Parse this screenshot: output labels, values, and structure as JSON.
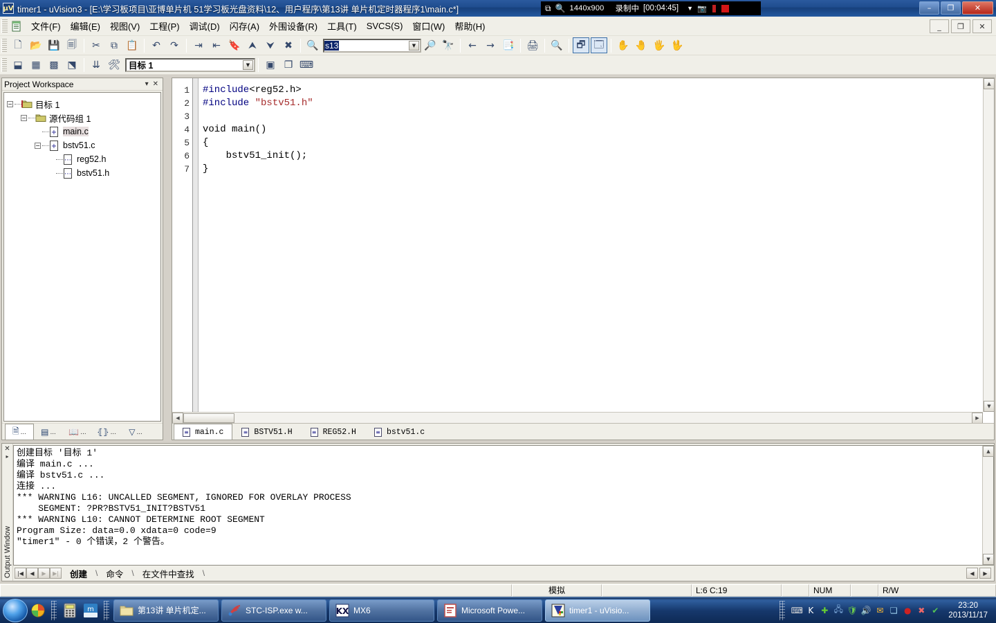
{
  "titlebar": {
    "text": "timer1  - uVision3 - [E:\\学习板项目\\亚博单片机 51学习板光盘资料\\12、用户程序\\第13讲 单片机定时器程序1\\main.c*]",
    "app_icon": "uvision-icon",
    "minimize": "–",
    "restore": "❐",
    "close": "✕"
  },
  "recorder": {
    "window_icon": "window-icon",
    "zoom_icon": "magnifier-icon",
    "resolution": "1440x900",
    "status": "录制中",
    "elapsed": "[00:04:45]",
    "caret": "▼",
    "camera_icon": "camera-icon",
    "pause_icon": "pause-icon",
    "stop_icon": "stop-icon"
  },
  "menubar": {
    "items": [
      {
        "label": "文件(F)"
      },
      {
        "label": "编辑(E)"
      },
      {
        "label": "视图(V)"
      },
      {
        "label": "工程(P)"
      },
      {
        "label": "调试(D)"
      },
      {
        "label": "闪存(A)"
      },
      {
        "label": "外围设备(R)"
      },
      {
        "label": "工具(T)"
      },
      {
        "label": "SVCS(S)"
      },
      {
        "label": "窗口(W)"
      },
      {
        "label": "帮助(H)"
      }
    ],
    "mdi_minimize": "_",
    "mdi_restore": "❐",
    "mdi_close": "✕"
  },
  "toolbar1": {
    "buttons": [
      {
        "name": "new-file-icon",
        "glyph": "🗋"
      },
      {
        "name": "open-file-icon",
        "glyph": "📂"
      },
      {
        "name": "save-icon",
        "glyph": "💾"
      },
      {
        "name": "save-all-icon",
        "glyph": "🗐"
      },
      {
        "name": "cut-icon",
        "glyph": "✂"
      },
      {
        "name": "copy-icon",
        "glyph": "⧉"
      },
      {
        "name": "paste-icon",
        "glyph": "📋"
      },
      {
        "name": "undo-icon",
        "glyph": "↶"
      },
      {
        "name": "redo-icon",
        "glyph": "↷"
      },
      {
        "name": "indent-icon",
        "glyph": "⇥"
      },
      {
        "name": "outdent-icon",
        "glyph": "⇤"
      },
      {
        "name": "bookmark-toggle-icon",
        "glyph": "🔖"
      },
      {
        "name": "bookmark-prev-icon",
        "glyph": "⮝"
      },
      {
        "name": "bookmark-next-icon",
        "glyph": "⮟"
      },
      {
        "name": "bookmark-clear-icon",
        "glyph": "✖"
      },
      {
        "name": "find-in-files-icon",
        "glyph": "🔍"
      }
    ],
    "search_value": "s13",
    "search_dropdown": "▼",
    "after_buttons": [
      {
        "name": "find-icon",
        "glyph": "🔎"
      },
      {
        "name": "find-next-icon",
        "glyph": "🔭"
      },
      {
        "name": "navigate-back-icon",
        "glyph": "←"
      },
      {
        "name": "navigate-forward-icon",
        "glyph": "→"
      },
      {
        "name": "bookmark-list-icon",
        "glyph": "📑"
      },
      {
        "name": "print-icon",
        "glyph": "🖨"
      },
      {
        "name": "print-preview-icon",
        "glyph": "🔍"
      },
      {
        "name": "project-window-icon",
        "glyph": "🗗"
      },
      {
        "name": "output-window-icon",
        "glyph": "🗔"
      },
      {
        "name": "debug-hand1-icon",
        "glyph": "✋"
      },
      {
        "name": "debug-hand2-icon",
        "glyph": "🤚"
      },
      {
        "name": "debug-hand3-icon",
        "glyph": "🖐"
      },
      {
        "name": "debug-hand4-icon",
        "glyph": "🖖"
      }
    ]
  },
  "toolbar2": {
    "buttons": [
      {
        "name": "build-icon",
        "glyph": "⬓"
      },
      {
        "name": "rebuild-icon",
        "glyph": "▦"
      },
      {
        "name": "build-all-icon",
        "glyph": "▩"
      },
      {
        "name": "stop-build-icon",
        "glyph": "⬔"
      },
      {
        "name": "download-icon",
        "glyph": "⇊"
      },
      {
        "name": "target-options-icon",
        "glyph": "🛠"
      }
    ],
    "target_value": "目标 1",
    "target_dropdown": "▼",
    "after_buttons": [
      {
        "name": "manage-components-icon",
        "glyph": "▣"
      },
      {
        "name": "multi-project-icon",
        "glyph": "❐"
      },
      {
        "name": "keyboard-icon",
        "glyph": "⌨"
      }
    ]
  },
  "project_workspace": {
    "title": "Project Workspace",
    "menu_caret": "▾",
    "close": "✕",
    "tree": [
      {
        "label": "目标 1",
        "level": 0,
        "expander": "−",
        "icon": "target-folder-icon",
        "selected": false
      },
      {
        "label": "源代码组 1",
        "level": 1,
        "expander": "−",
        "icon": "source-group-folder-icon",
        "selected": false
      },
      {
        "label": "main.c",
        "level": 2,
        "expander": "",
        "icon": "c-file-icon",
        "selected": true
      },
      {
        "label": "bstv51.c",
        "level": 2,
        "expander": "−",
        "icon": "c-file-icon",
        "selected": false
      },
      {
        "label": "reg52.h",
        "level": 3,
        "expander": "",
        "icon": "h-file-icon",
        "selected": false
      },
      {
        "label": "bstv51.h",
        "level": 3,
        "expander": "",
        "icon": "h-file-icon",
        "selected": false
      }
    ],
    "tabs": [
      {
        "name": "files-tab",
        "glyph": "🗎",
        "label": "...",
        "active": true
      },
      {
        "name": "regs-tab",
        "glyph": "▤",
        "label": "...",
        "active": false
      },
      {
        "name": "books-tab",
        "glyph": "📖",
        "label": "...",
        "active": false
      },
      {
        "name": "functions-tab",
        "glyph": "⦃⦄",
        "label": "...",
        "active": false
      },
      {
        "name": "templates-tab",
        "glyph": "▽",
        "label": "...",
        "active": false
      }
    ]
  },
  "editor": {
    "line_numbers": [
      "1",
      "2",
      "3",
      "4",
      "5",
      "6",
      "7"
    ],
    "lines": [
      {
        "segments": [
          {
            "text": "#include",
            "style": "kw-inc"
          },
          {
            "text": "<reg52.h>",
            "style": "plain"
          }
        ]
      },
      {
        "segments": [
          {
            "text": "#include",
            "style": "kw-inc"
          },
          {
            "text": " ",
            "style": "plain"
          },
          {
            "text": "\"bstv51.h\"",
            "style": "str"
          }
        ]
      },
      {
        "segments": [
          {
            "text": "",
            "style": "plain"
          }
        ]
      },
      {
        "segments": [
          {
            "text": "void main()",
            "style": "plain"
          }
        ]
      },
      {
        "segments": [
          {
            "text": "{",
            "style": "plain"
          }
        ]
      },
      {
        "segments": [
          {
            "text": "    bstv51_init();",
            "style": "plain"
          }
        ]
      },
      {
        "segments": [
          {
            "text": "}",
            "style": "plain"
          }
        ]
      }
    ],
    "scroll_up": "▲",
    "scroll_down": "▼",
    "scroll_left": "◀",
    "scroll_right": "▶",
    "tabs": [
      {
        "label": "main.c",
        "active": true
      },
      {
        "label": "BSTV51.H",
        "active": false
      },
      {
        "label": "REG52.H",
        "active": false
      },
      {
        "label": "bstv51.c",
        "active": false
      }
    ]
  },
  "output_window": {
    "vertical_label": "Output Window",
    "close": "✕",
    "pin": "▸",
    "text": "创建目标 '目标 1'\n编译 main.c ...\n编译 bstv51.c ...\n连接 ...\n*** WARNING L16: UNCALLED SEGMENT, IGNORED FOR OVERLAY PROCESS\n    SEGMENT: ?PR?BSTV51_INIT?BSTV51\n*** WARNING L10: CANNOT DETERMINE ROOT SEGMENT\nProgram Size: data=0.0 xdata=0 code=9\n\"timer1\" - 0 个错误，2 个警告。",
    "nav_first": "|◀",
    "nav_prev": "◀",
    "nav_next": "▶",
    "nav_last": "▶|",
    "tabs": [
      {
        "label": "创建",
        "active": true
      },
      {
        "label": "命令",
        "active": false
      },
      {
        "label": "在文件中查找",
        "active": false
      }
    ],
    "scroll_up": "▲",
    "scroll_down": "▼",
    "scroll_left": "◀",
    "scroll_right": "▶"
  },
  "statusbar": {
    "mode": "模拟",
    "empty1": "",
    "cursor": "L:6 C:19",
    "empty2": "",
    "num": "NUM",
    "empty3": "",
    "empty4": "",
    "rw": "R/W"
  },
  "taskbar": {
    "start": "start-orb",
    "quick_launch": [
      {
        "name": "media-player-icon",
        "glyph": "◕"
      },
      {
        "name": "calculator-icon",
        "glyph": "🖩"
      },
      {
        "name": "maxthon-icon",
        "glyph": "m"
      }
    ],
    "buttons": [
      {
        "name": "taskbar-item-folder",
        "label": "第13讲 单片机定...",
        "icon": "folder-icon",
        "active": false
      },
      {
        "name": "taskbar-item-stcisp",
        "label": "STC-ISP.exe   w...",
        "icon": "stc-icon",
        "active": false
      },
      {
        "name": "taskbar-item-mx6",
        "label": "MX6",
        "icon": "mx6-icon",
        "active": false
      },
      {
        "name": "taskbar-item-powerpoint",
        "label": "Microsoft Powe...",
        "icon": "powerpoint-icon",
        "active": false
      },
      {
        "name": "taskbar-item-uvision",
        "label": "timer1  - uVisio...",
        "icon": "uvision-icon",
        "active": true
      }
    ],
    "tray": [
      {
        "name": "keyboard-tray-icon",
        "glyph": "⌨",
        "color": "#d8d8d8"
      },
      {
        "name": "kx-audio-icon",
        "glyph": "K",
        "color": "#ffffff"
      },
      {
        "name": "update-icon",
        "glyph": "✚",
        "color": "#66cc33"
      },
      {
        "name": "network-icon",
        "glyph": "🖧",
        "color": "#7ba7d8"
      },
      {
        "name": "shield-icon",
        "glyph": "🛡",
        "color": "#6ece4e"
      },
      {
        "name": "volume-icon",
        "glyph": "🔊",
        "color": "#e8e8e8"
      },
      {
        "name": "mail-icon",
        "glyph": "✉",
        "color": "#ffbb33"
      },
      {
        "name": "app-icon",
        "glyph": "❏",
        "color": "#9fd2f0"
      },
      {
        "name": "record-icon",
        "glyph": "●",
        "color": "#cc2222"
      },
      {
        "name": "antivirus-icon",
        "glyph": "✖",
        "color": "#f06868"
      },
      {
        "name": "safe-icon",
        "glyph": "✔",
        "color": "#54c454"
      }
    ],
    "clock_time": "23:20",
    "clock_date": "2013/11/17"
  }
}
